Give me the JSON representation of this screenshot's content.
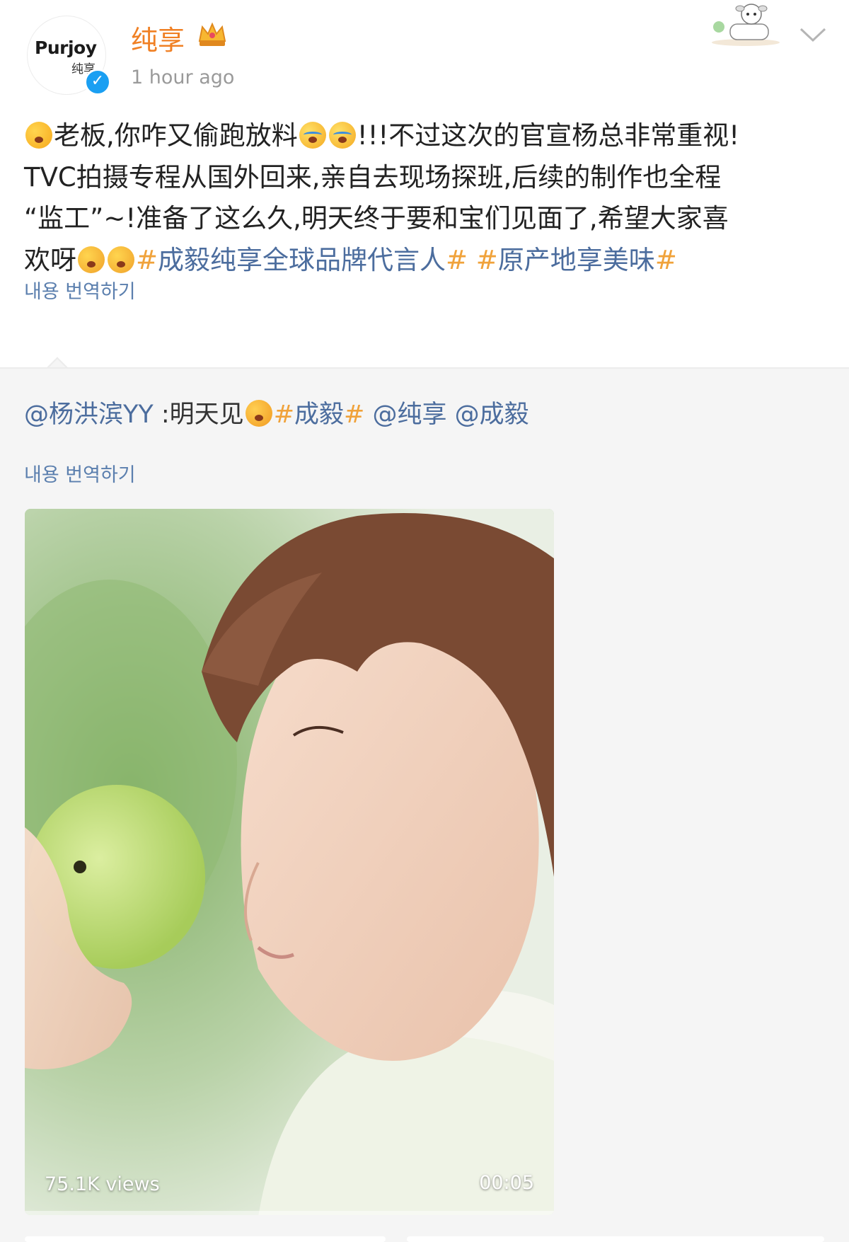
{
  "post": {
    "username": "纯享",
    "timestamp": "1 hour ago",
    "logo_text_en": "Purjoy",
    "logo_text_cn": "纯享",
    "text_line1_a": "老板,你咋又偷跑放料",
    "text_line1_b": "!!!不过这次的官宣杨总非常重视!",
    "text_line2": "TVC拍摄专程从国外回来,亲自去现场探班,后续的制作也全程",
    "text_line3": "“监工”~!准备了这么久,明天终于要和宝们见面了,希望大家喜",
    "text_line4_a": "欢呀",
    "topic1": "成毅纯享全球品牌代言人",
    "topic2": "原产地享美味",
    "hash_symbol": "#",
    "translate_label": "내용 번역하기",
    "colors": {
      "username": "#f08024",
      "link": "#4c6d9e",
      "hash": "#f0a23a"
    },
    "icons": [
      "verified-badge-icon",
      "crown-icon",
      "chevron-down-icon",
      "sticker-decoration"
    ]
  },
  "repost": {
    "author_mention": "@杨洪滨YY",
    "separator": " :明天见",
    "topic": "成毅",
    "mention1": "@纯享",
    "mention2": "@成毅",
    "hash_symbol": "#",
    "translate_label": "내용 번역하기",
    "video": {
      "views": "75.1K views",
      "duration": "00:05",
      "progress_fraction": 0.0
    }
  }
}
